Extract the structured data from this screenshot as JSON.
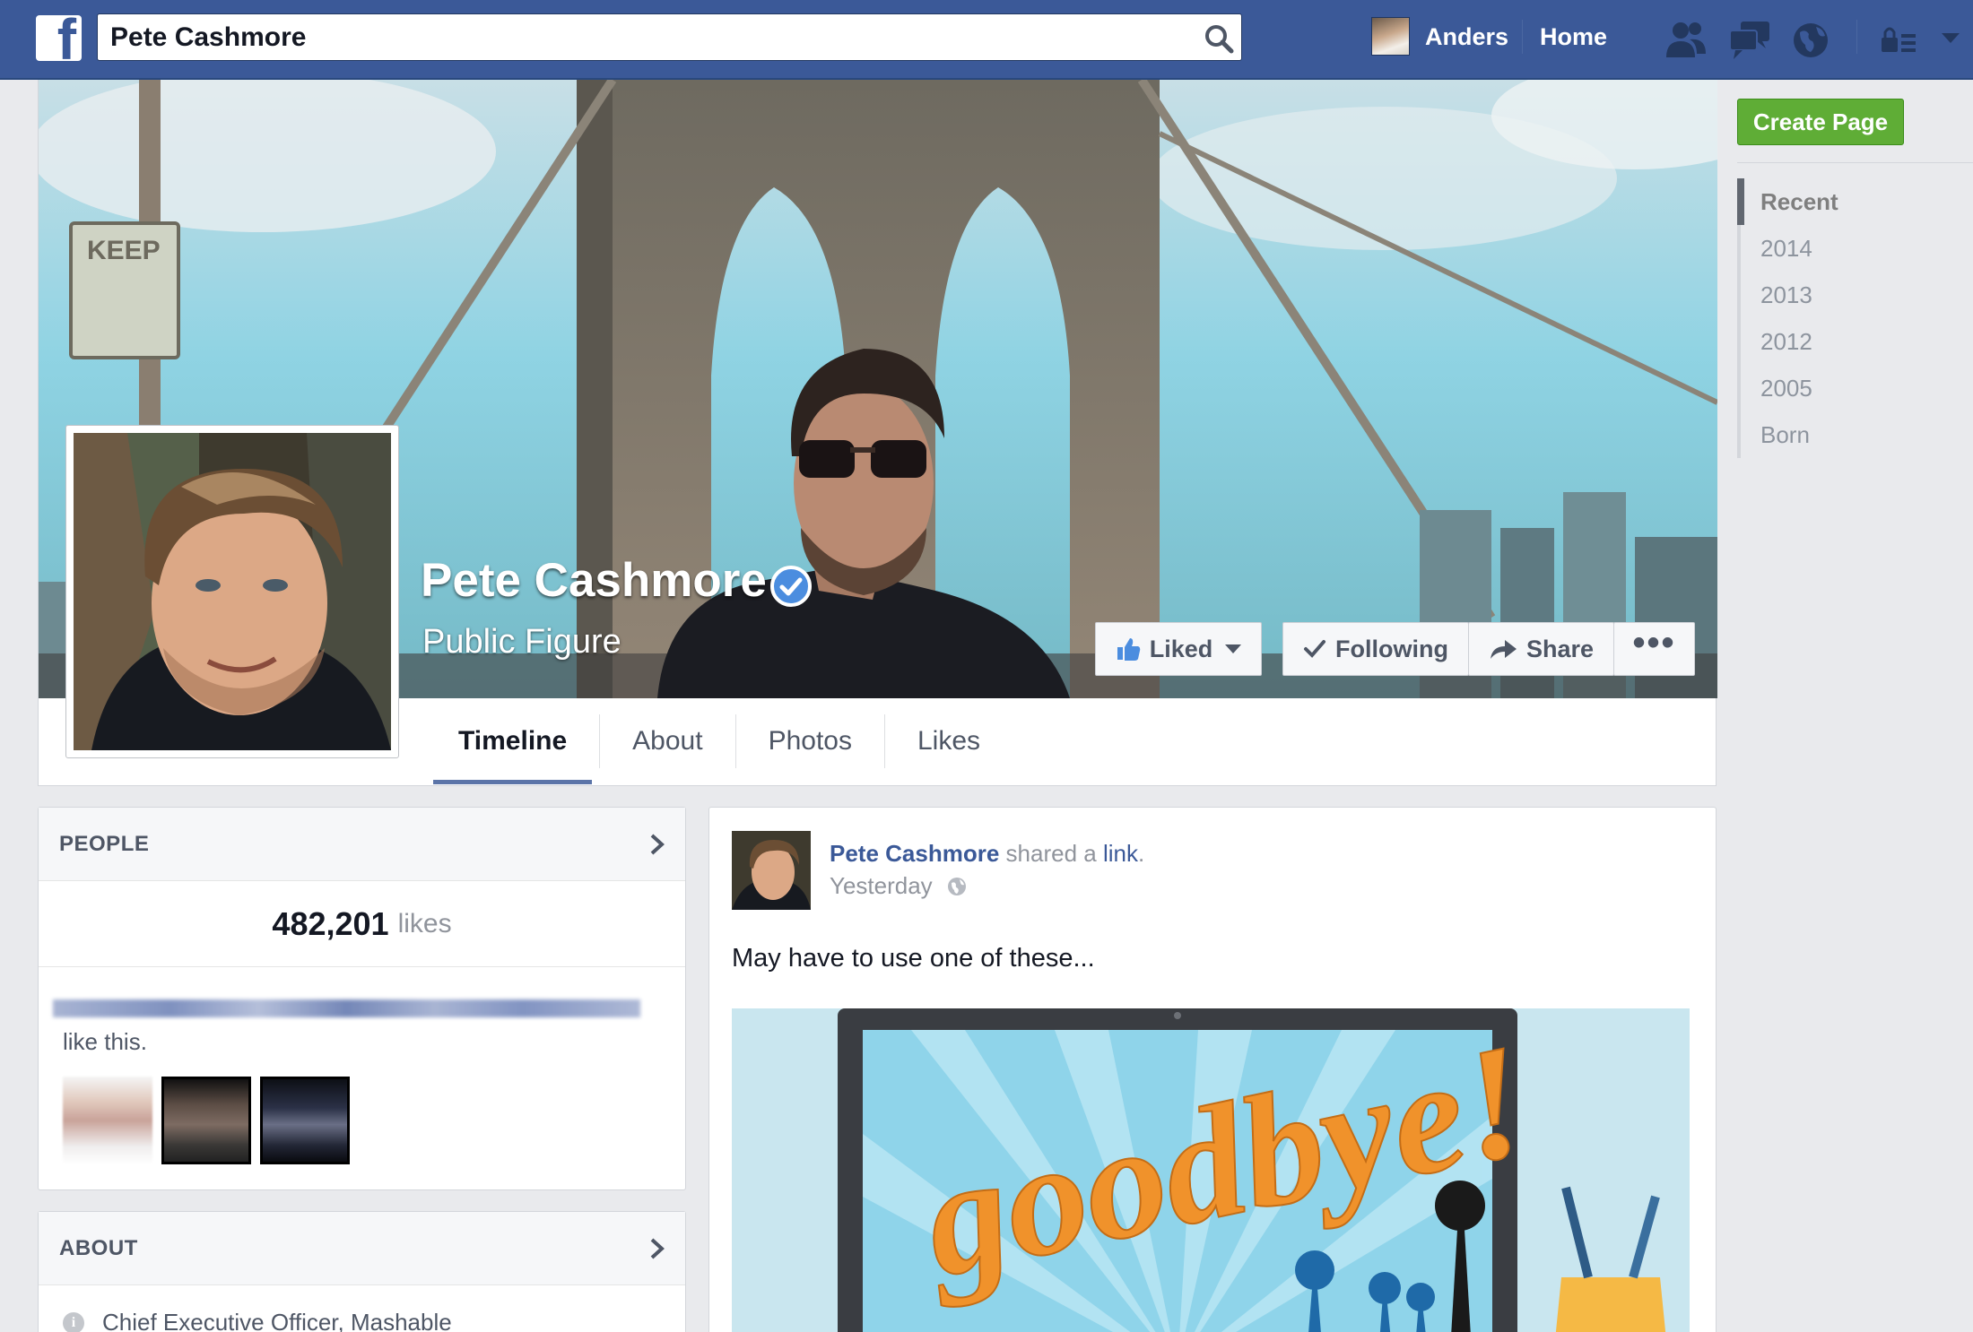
{
  "topbar": {
    "logo_letter": "f",
    "search_value": "Pete Cashmore",
    "user_name": "Anders",
    "home_label": "Home"
  },
  "profile": {
    "name": "Pete Cashmore",
    "category": "Public Figure",
    "verified": true
  },
  "cover_buttons": {
    "liked": "Liked",
    "following": "Following",
    "share": "Share",
    "more": "•••"
  },
  "tabs": [
    {
      "label": "Timeline",
      "active": true
    },
    {
      "label": "About",
      "active": false
    },
    {
      "label": "Photos",
      "active": false
    },
    {
      "label": "Likes",
      "active": false
    }
  ],
  "right_column": {
    "create_page": "Create Page",
    "years": [
      {
        "label": "Recent",
        "active": true
      },
      {
        "label": "2014"
      },
      {
        "label": "2013"
      },
      {
        "label": "2012"
      },
      {
        "label": "2005"
      },
      {
        "label": "Born"
      }
    ]
  },
  "people_card": {
    "title": "PEOPLE",
    "likes_count": "482,201",
    "likes_word": "likes",
    "like_this": "like this."
  },
  "about_card": {
    "title": "ABOUT",
    "item": "Chief Executive Officer, Mashable"
  },
  "post": {
    "author": "Pete Cashmore",
    "action": " shared a ",
    "link_word": "link",
    "period": ".",
    "time": "Yesterday",
    "text": "May have to use one of these...",
    "image_text": "goodbye!"
  },
  "colors": {
    "brand_blue": "#3b5998",
    "create_green": "#5fad36",
    "verified_blue": "#4b8ddf"
  }
}
